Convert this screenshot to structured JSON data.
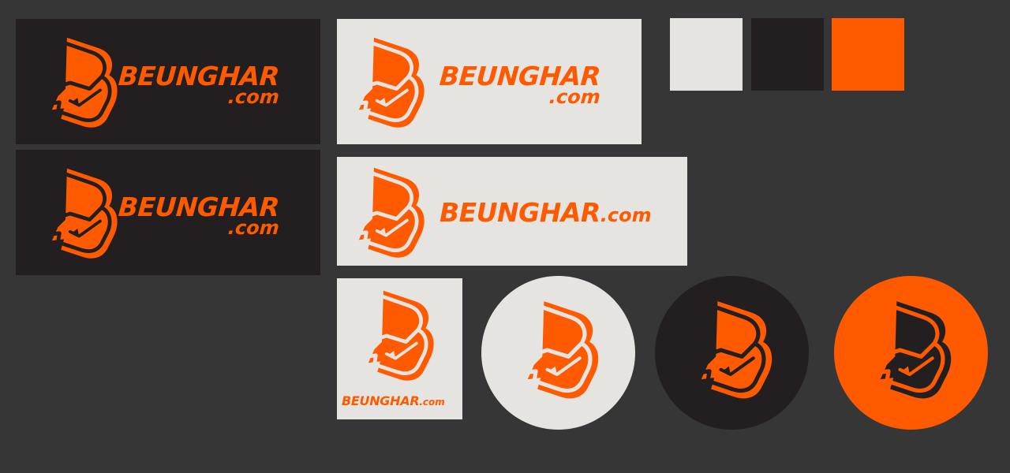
{
  "brand": {
    "name": "BEUNGHAR",
    "domain": ".com"
  },
  "colors": {
    "primary_orange": "#ff5a00",
    "dark": "#231f20",
    "light": "#e6e4e1",
    "background": "#363636"
  },
  "swatches": [
    {
      "name": "light",
      "hex": "#e6e4e1"
    },
    {
      "name": "dark",
      "hex": "#231f20"
    },
    {
      "name": "orange",
      "hex": "#ff5a00"
    }
  ],
  "icons": {
    "logo_mark": "b-letter-logo-icon"
  }
}
